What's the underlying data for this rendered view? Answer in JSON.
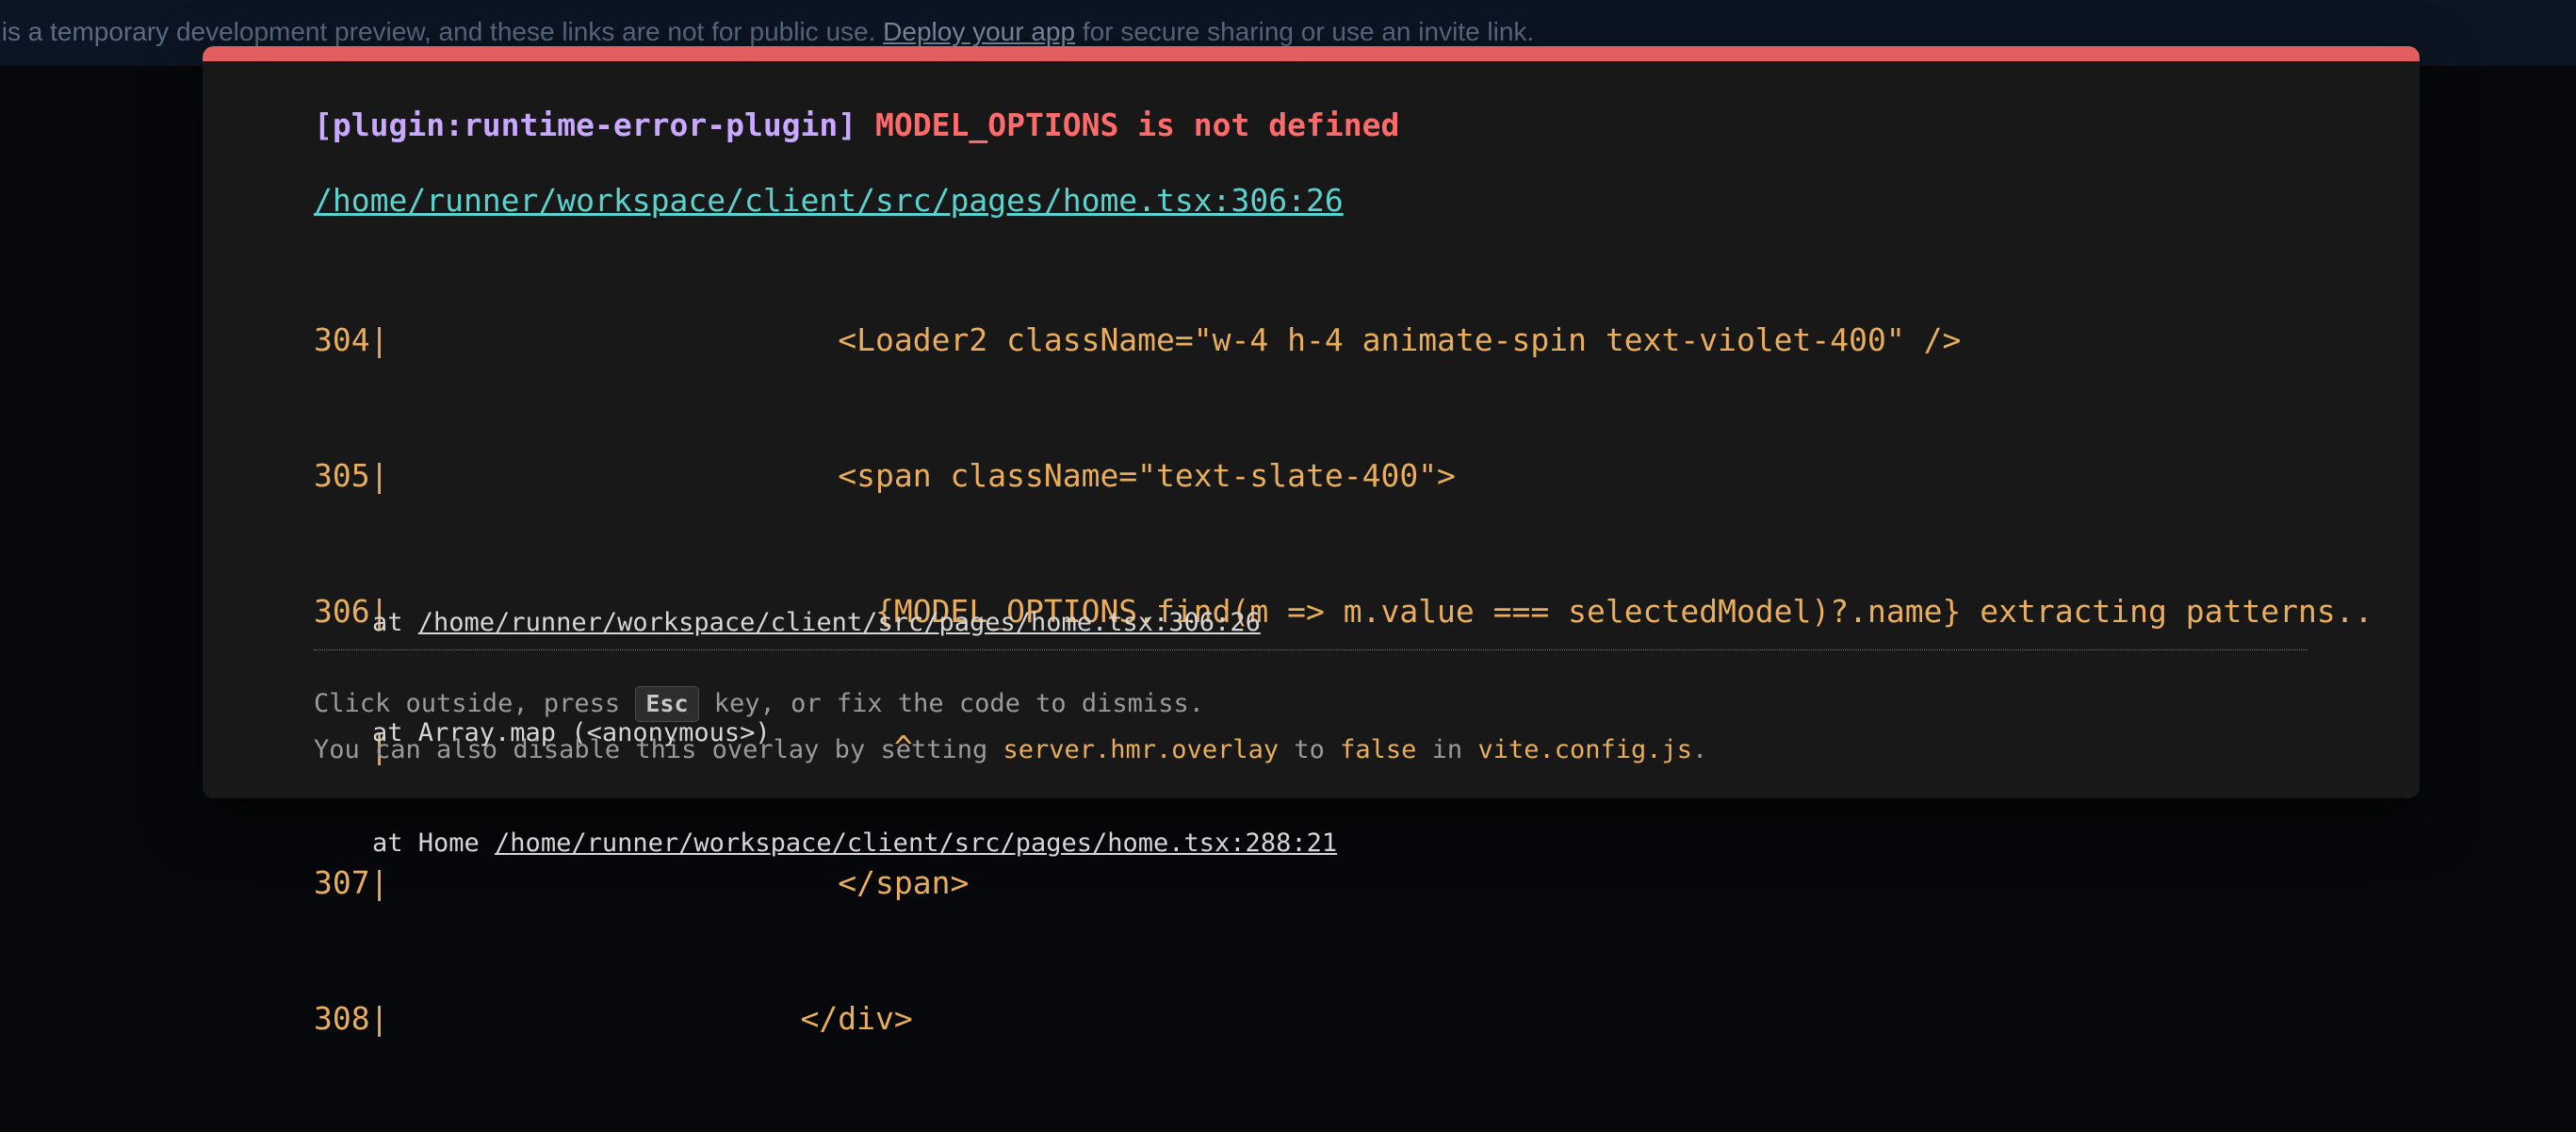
{
  "banner": {
    "text_before": "s is a temporary development preview, and these links are not for public use. ",
    "link": "Deploy your app",
    "text_after": " for secure sharing or use an invite link."
  },
  "overlay": {
    "plugin": "[plugin:runtime-error-plugin]",
    "message": "MODEL_OPTIONS is not defined",
    "file": "/home/runner/workspace/client/src/pages/home.tsx:306:26",
    "frame": [
      "304|                        <Loader2 className=\"w-4 h-4 animate-spin text-violet-400\" />",
      "305|                        <span className=\"text-slate-400\">",
      "306|                          {MODEL_OPTIONS.find(m => m.value === selectedModel)?.name} extracting patterns..",
      "   |                           ^",
      "307|                        </span>",
      "308|                      </div>"
    ],
    "stack": [
      {
        "prefix": "at ",
        "link": "/home/runner/workspace/client/src/pages/home.tsx:306:26",
        "suffix": ""
      },
      {
        "prefix": "at Array.map (<anonymous>)",
        "link": "",
        "suffix": ""
      },
      {
        "prefix": "at Home ",
        "link": "/home/runner/workspace/client/src/pages/home.tsx:288:21",
        "suffix": ""
      }
    ],
    "tip": {
      "line1_a": "Click outside, press ",
      "key": "Esc",
      "line1_b": " key, or fix the code to dismiss.",
      "line2_a": "You can also disable this overlay by setting ",
      "setting": "server.hmr.overlay",
      "line2_b": " to ",
      "value": "false",
      "line2_c": " in ",
      "config": "vite.config.js",
      "line2_d": "."
    }
  },
  "colors": {
    "accent_bar": "#e35f5f",
    "plugin": "#c9a8ff",
    "error": "#ff6b6b",
    "file_link": "#5cd2cf",
    "code": "#e8ad5d"
  }
}
